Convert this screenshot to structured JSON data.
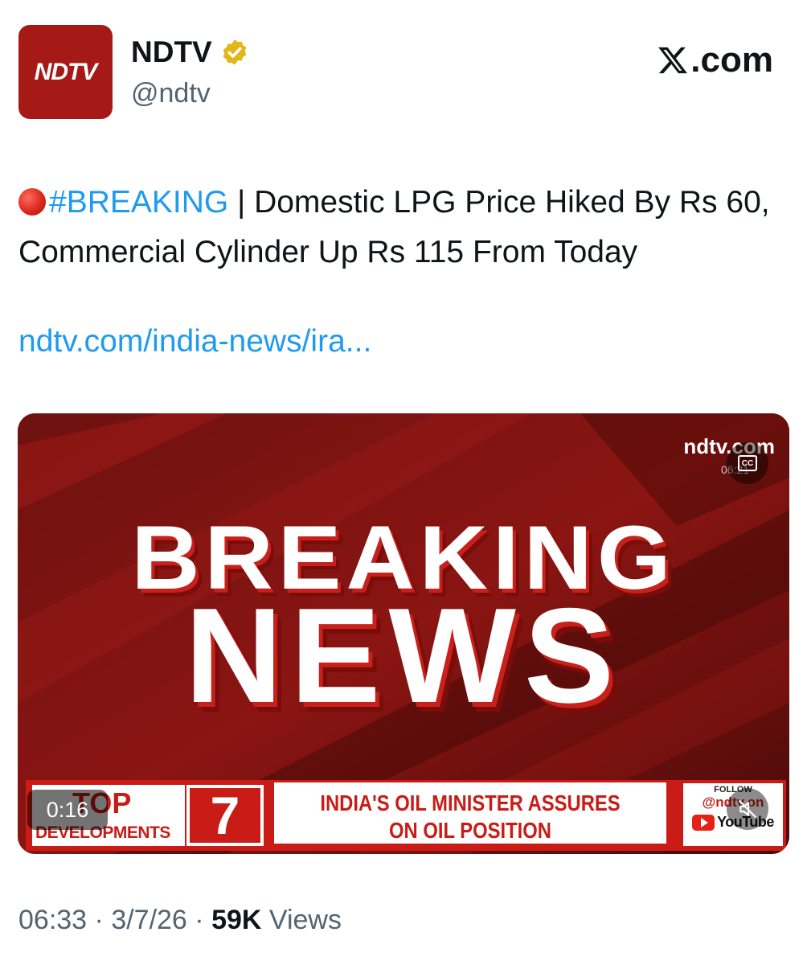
{
  "account": {
    "avatar_text": "NDTV",
    "name": "NDTV",
    "handle": "@ndtv",
    "verified_icon": "gold-verified-badge-icon"
  },
  "brand": {
    "label": ".com",
    "logo_icon": "x-logo-icon"
  },
  "tweet": {
    "dot_icon": "red-circle-emoji",
    "hashtag": "#BREAKING",
    "separator": " | ",
    "body": "Domestic LPG Price Hiked By Rs 60, Commercial Cylinder Up Rs 115 From Today",
    "link": "ndtv.com/india-news/ira..."
  },
  "video": {
    "line1": "BREAKING",
    "line2": "NEWS",
    "watermark": "ndtv.com",
    "watermark_time": "06:21",
    "cc_label": "CC",
    "elapsed": "0:16",
    "ticker": {
      "top_word": "TOP",
      "developments_word": "DEVELOPMENTS",
      "number": "7",
      "headline_line1": "INDIA'S OIL MINISTER ASSURES",
      "headline_line2": "ON OIL POSITION",
      "follow_label": "FOLLOW",
      "follow_handle": "@ndtv.on",
      "youtube_label": "YouTube"
    }
  },
  "meta": {
    "time": "06:33",
    "date": "3/7/26",
    "views_count": "59K",
    "views_label": "Views",
    "dot": " · "
  },
  "colors": {
    "accent_link": "#1d9bf0",
    "ndtv_red": "#a51916",
    "muted_text": "#536471"
  }
}
